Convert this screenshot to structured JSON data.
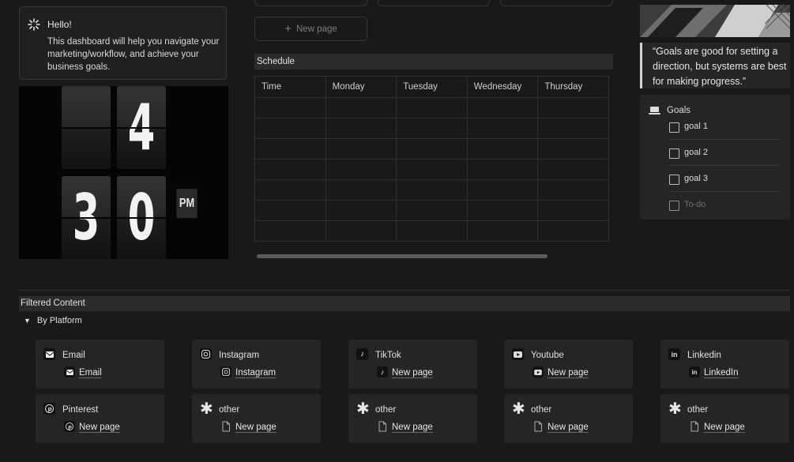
{
  "callout": {
    "title": "Hello!",
    "body": "This dashboard will help you navigate your marketing/workflow, and achieve your business goals."
  },
  "clock": {
    "hour": "4",
    "minute_tens": "3",
    "minute_ones": "0",
    "period": "PM"
  },
  "new_page_button": {
    "label": "New page"
  },
  "schedule": {
    "title": "Schedule",
    "columns": [
      "Time",
      "Monday",
      "Tuesday",
      "Wednesday",
      "Thursday"
    ]
  },
  "quote": {
    "text": "“Goals are good for setting a direction, but systems are best for making progress.”"
  },
  "goals": {
    "title": "Goals",
    "items": [
      "goal 1",
      "goal 2",
      "goal 3"
    ],
    "placeholder": "To-do"
  },
  "filtered": {
    "title": "Filtered Content",
    "group_label": "By Platform",
    "tiles": [
      {
        "name": "Email",
        "page": "Email"
      },
      {
        "name": "Instagram",
        "page": "Instagram"
      },
      {
        "name": "TikTok",
        "page": "New page"
      },
      {
        "name": "Youtube",
        "page": "New page"
      },
      {
        "name": "Linkedin",
        "page": "LinkedIn"
      },
      {
        "name": "Pinterest",
        "page": "New page"
      },
      {
        "name": "other",
        "page": "New page"
      },
      {
        "name": "other",
        "page": "New page"
      },
      {
        "name": "other",
        "page": "New page"
      },
      {
        "name": "other",
        "page": "New page"
      }
    ]
  },
  "colors": {
    "background": "#191919",
    "panel": "#252525",
    "text": "#d4d4d4",
    "muted": "#7d7d7d"
  }
}
